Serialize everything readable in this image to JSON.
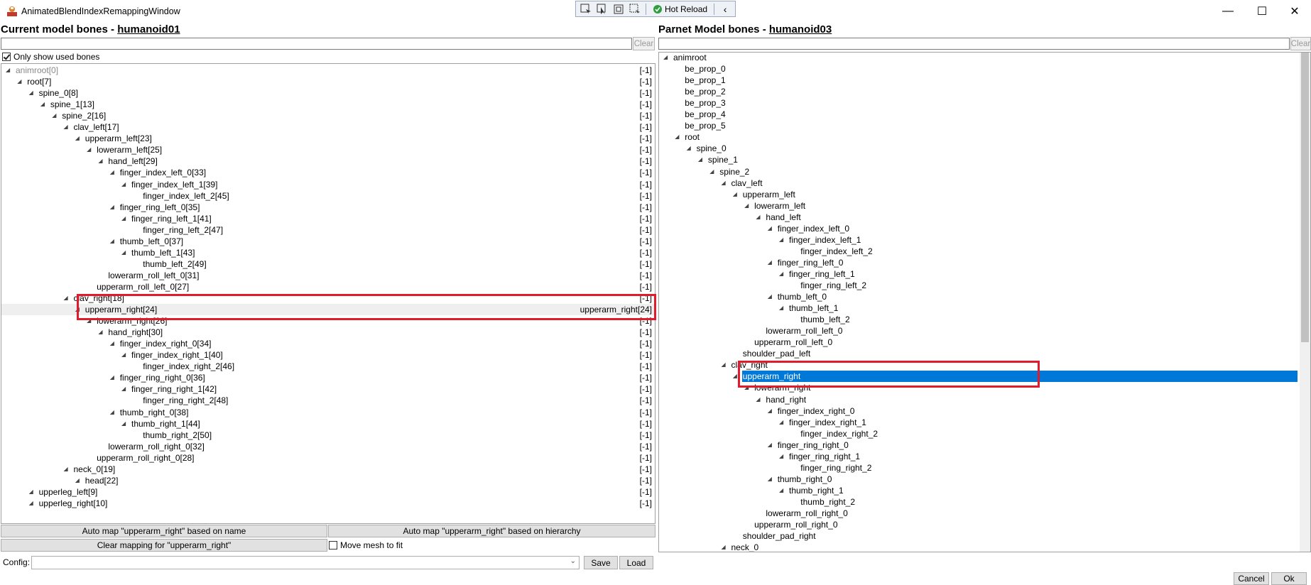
{
  "window": {
    "title": "AnimatedBlendIndexRemappingWindow",
    "min_glyph": "—",
    "max_glyph": "☐",
    "close_glyph": "✕"
  },
  "toolbar": {
    "hot_reload_label": "Hot Reload",
    "collapse_glyph": "‹"
  },
  "left": {
    "title_prefix": "Current model bones - ",
    "title_model": "humanoid01",
    "search_value": "",
    "clear_label": "Clear",
    "only_used_label": "Only show used bones",
    "bones": [
      {
        "label": "animroot[0]",
        "depth": 0,
        "map": "[-1]",
        "dim": true
      },
      {
        "label": "root[7]",
        "depth": 1,
        "map": "[-1]"
      },
      {
        "label": "spine_0[8]",
        "depth": 2,
        "map": "[-1]"
      },
      {
        "label": "spine_1[13]",
        "depth": 3,
        "map": "[-1]"
      },
      {
        "label": "spine_2[16]",
        "depth": 4,
        "map": "[-1]"
      },
      {
        "label": "clav_left[17]",
        "depth": 5,
        "map": "[-1]"
      },
      {
        "label": "upperarm_left[23]",
        "depth": 6,
        "map": "[-1]"
      },
      {
        "label": "lowerarm_left[25]",
        "depth": 7,
        "map": "[-1]"
      },
      {
        "label": "hand_left[29]",
        "depth": 8,
        "map": "[-1]"
      },
      {
        "label": "finger_index_left_0[33]",
        "depth": 9,
        "map": "[-1]"
      },
      {
        "label": "finger_index_left_1[39]",
        "depth": 10,
        "map": "[-1]"
      },
      {
        "label": "finger_index_left_2[45]",
        "depth": 11,
        "map": "[-1]",
        "leaf": true
      },
      {
        "label": "finger_ring_left_0[35]",
        "depth": 9,
        "map": "[-1]"
      },
      {
        "label": "finger_ring_left_1[41]",
        "depth": 10,
        "map": "[-1]"
      },
      {
        "label": "finger_ring_left_2[47]",
        "depth": 11,
        "map": "[-1]",
        "leaf": true
      },
      {
        "label": "thumb_left_0[37]",
        "depth": 9,
        "map": "[-1]"
      },
      {
        "label": "thumb_left_1[43]",
        "depth": 10,
        "map": "[-1]"
      },
      {
        "label": "thumb_left_2[49]",
        "depth": 11,
        "map": "[-1]",
        "leaf": true
      },
      {
        "label": "lowerarm_roll_left_0[31]",
        "depth": 8,
        "map": "[-1]",
        "leaf": true
      },
      {
        "label": "upperarm_roll_left_0[27]",
        "depth": 7,
        "map": "[-1]",
        "leaf": true
      },
      {
        "label": "clav_right[18]",
        "depth": 5,
        "map": "[-1]"
      },
      {
        "label": "upperarm_right[24]",
        "depth": 6,
        "map": "upperarm_right[24]",
        "selected": true
      },
      {
        "label": "lowerarm_right[26]",
        "depth": 7,
        "map": "[-1]"
      },
      {
        "label": "hand_right[30]",
        "depth": 8,
        "map": "[-1]"
      },
      {
        "label": "finger_index_right_0[34]",
        "depth": 9,
        "map": "[-1]"
      },
      {
        "label": "finger_index_right_1[40]",
        "depth": 10,
        "map": "[-1]"
      },
      {
        "label": "finger_index_right_2[46]",
        "depth": 11,
        "map": "[-1]",
        "leaf": true
      },
      {
        "label": "finger_ring_right_0[36]",
        "depth": 9,
        "map": "[-1]"
      },
      {
        "label": "finger_ring_right_1[42]",
        "depth": 10,
        "map": "[-1]"
      },
      {
        "label": "finger_ring_right_2[48]",
        "depth": 11,
        "map": "[-1]",
        "leaf": true
      },
      {
        "label": "thumb_right_0[38]",
        "depth": 9,
        "map": "[-1]"
      },
      {
        "label": "thumb_right_1[44]",
        "depth": 10,
        "map": "[-1]"
      },
      {
        "label": "thumb_right_2[50]",
        "depth": 11,
        "map": "[-1]",
        "leaf": true
      },
      {
        "label": "lowerarm_roll_right_0[32]",
        "depth": 8,
        "map": "[-1]",
        "leaf": true
      },
      {
        "label": "upperarm_roll_right_0[28]",
        "depth": 7,
        "map": "[-1]",
        "leaf": true
      },
      {
        "label": "neck_0[19]",
        "depth": 5,
        "map": "[-1]"
      },
      {
        "label": "head[22]",
        "depth": 6,
        "map": "[-1]"
      },
      {
        "label": "upperleg_left[9]",
        "depth": 2,
        "map": "[-1]"
      },
      {
        "label": "upperleg_right[10]",
        "depth": 2,
        "map": "[-1]"
      }
    ],
    "auto_name_label": "Auto map \"upperarm_right\" based on name",
    "auto_hier_label": "Auto map \"upperarm_right\" based on hierarchy",
    "clear_mapping_label": "Clear mapping for \"upperarm_right\"",
    "move_mesh_label": "Move mesh to fit"
  },
  "right": {
    "title_prefix": "Parnet Model bones - ",
    "title_model": "humanoid03",
    "search_value": "",
    "clear_label": "Clear",
    "bones": [
      {
        "label": "animroot",
        "depth": 0
      },
      {
        "label": "be_prop_0",
        "depth": 1,
        "leaf": true
      },
      {
        "label": "be_prop_1",
        "depth": 1,
        "leaf": true
      },
      {
        "label": "be_prop_2",
        "depth": 1,
        "leaf": true
      },
      {
        "label": "be_prop_3",
        "depth": 1,
        "leaf": true
      },
      {
        "label": "be_prop_4",
        "depth": 1,
        "leaf": true
      },
      {
        "label": "be_prop_5",
        "depth": 1,
        "leaf": true
      },
      {
        "label": "root",
        "depth": 1
      },
      {
        "label": "spine_0",
        "depth": 2
      },
      {
        "label": "spine_1",
        "depth": 3
      },
      {
        "label": "spine_2",
        "depth": 4
      },
      {
        "label": "clav_left",
        "depth": 5
      },
      {
        "label": "upperarm_left",
        "depth": 6
      },
      {
        "label": "lowerarm_left",
        "depth": 7
      },
      {
        "label": "hand_left",
        "depth": 8
      },
      {
        "label": "finger_index_left_0",
        "depth": 9
      },
      {
        "label": "finger_index_left_1",
        "depth": 10
      },
      {
        "label": "finger_index_left_2",
        "depth": 11,
        "leaf": true
      },
      {
        "label": "finger_ring_left_0",
        "depth": 9
      },
      {
        "label": "finger_ring_left_1",
        "depth": 10
      },
      {
        "label": "finger_ring_left_2",
        "depth": 11,
        "leaf": true
      },
      {
        "label": "thumb_left_0",
        "depth": 9
      },
      {
        "label": "thumb_left_1",
        "depth": 10
      },
      {
        "label": "thumb_left_2",
        "depth": 11,
        "leaf": true
      },
      {
        "label": "lowerarm_roll_left_0",
        "depth": 8,
        "leaf": true
      },
      {
        "label": "upperarm_roll_left_0",
        "depth": 7,
        "leaf": true
      },
      {
        "label": "shoulder_pad_left",
        "depth": 6,
        "leaf": true
      },
      {
        "label": "clav_right",
        "depth": 5
      },
      {
        "label": "upperarm_right",
        "depth": 6,
        "selected": true
      },
      {
        "label": "lowerarm_right",
        "depth": 7
      },
      {
        "label": "hand_right",
        "depth": 8
      },
      {
        "label": "finger_index_right_0",
        "depth": 9
      },
      {
        "label": "finger_index_right_1",
        "depth": 10
      },
      {
        "label": "finger_index_right_2",
        "depth": 11,
        "leaf": true
      },
      {
        "label": "finger_ring_right_0",
        "depth": 9
      },
      {
        "label": "finger_ring_right_1",
        "depth": 10
      },
      {
        "label": "finger_ring_right_2",
        "depth": 11,
        "leaf": true
      },
      {
        "label": "thumb_right_0",
        "depth": 9
      },
      {
        "label": "thumb_right_1",
        "depth": 10
      },
      {
        "label": "thumb_right_2",
        "depth": 11,
        "leaf": true
      },
      {
        "label": "lowerarm_roll_right_0",
        "depth": 8,
        "leaf": true
      },
      {
        "label": "upperarm_roll_right_0",
        "depth": 7,
        "leaf": true
      },
      {
        "label": "shoulder_pad_right",
        "depth": 6,
        "leaf": true
      },
      {
        "label": "neck_0",
        "depth": 5
      }
    ]
  },
  "bottom": {
    "config_label": "Config:",
    "config_value": "",
    "save_label": "Save",
    "load_label": "Load",
    "cancel_label": "Cancel",
    "ok_label": "Ok"
  },
  "colors": {
    "highlight_red": "#e21b2c",
    "selection_blue": "#0078d7"
  }
}
